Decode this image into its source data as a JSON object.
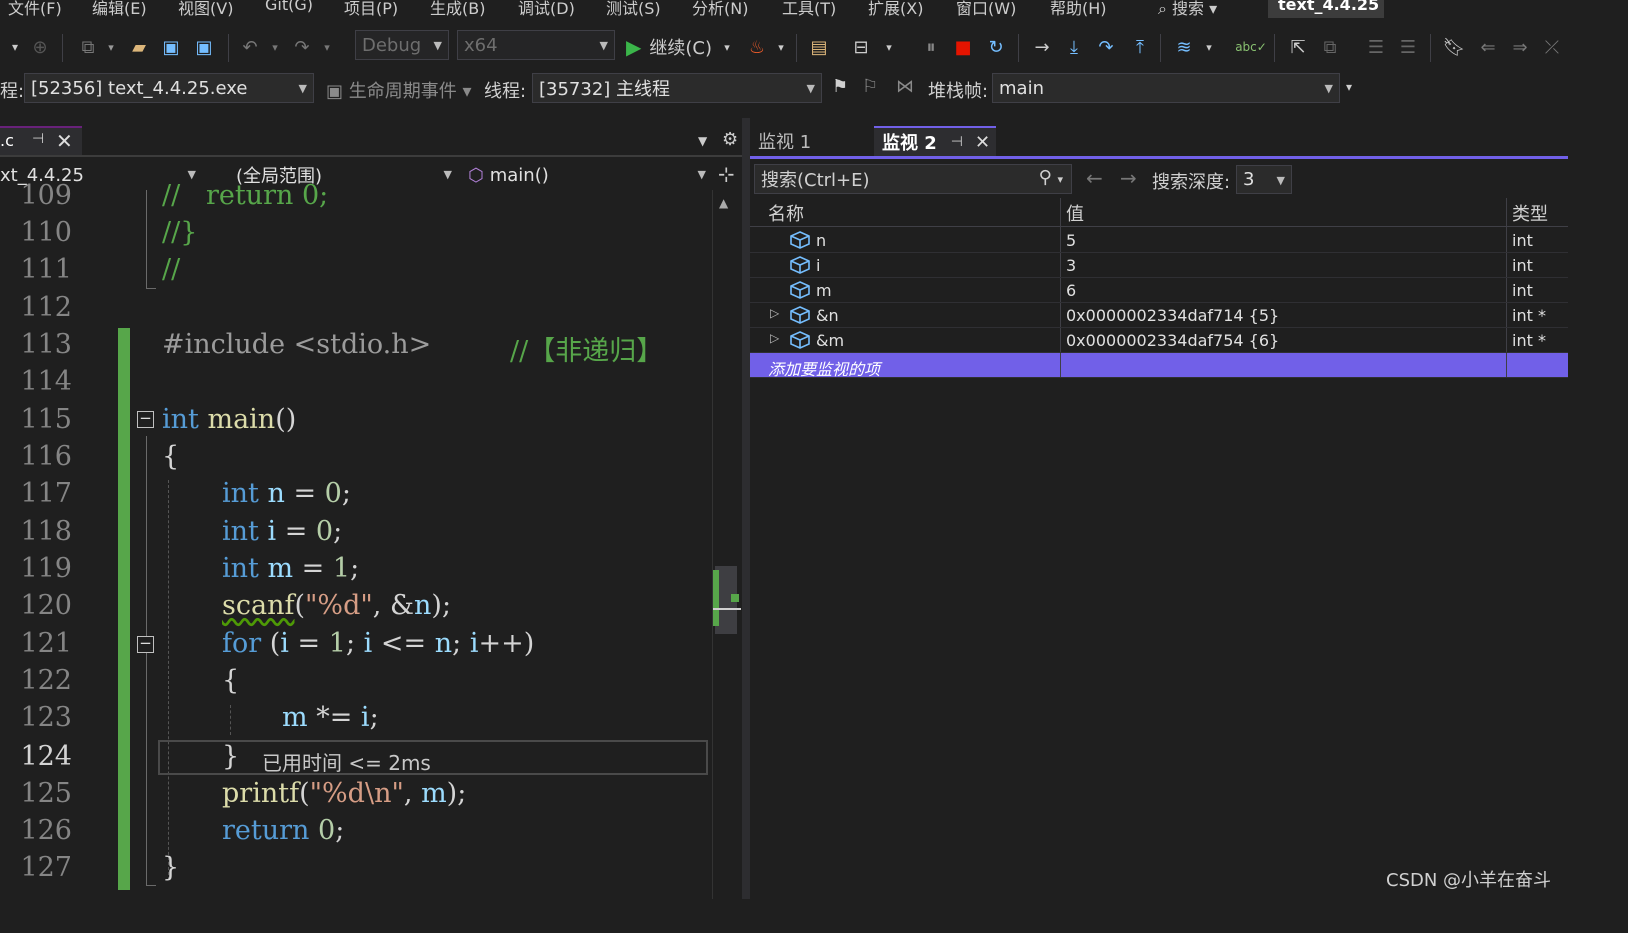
{
  "menu": [
    "文件(F)",
    "编辑(E)",
    "视图(V)",
    "Git(G)",
    "项目(P)",
    "生成(B)",
    "调试(D)",
    "测试(S)",
    "分析(N)",
    "工具(T)",
    "扩展(X)",
    "窗口(W)",
    "帮助(H)"
  ],
  "search_menu": "搜索",
  "project_title": "text_4.4.25",
  "toolbar": {
    "config": "Debug",
    "platform": "x64",
    "continue_label": "继续(C)"
  },
  "location": {
    "process_prefix": "程:",
    "process": "[52356] text_4.4.25.exe",
    "lifecycle": "生命周期事件",
    "thread_label": "线程:",
    "thread": "[35732] 主线程",
    "stack_label": "堆栈帧:",
    "stack": "main"
  },
  "editor": {
    "tab_label": ".c",
    "nav_project": "xt_4.4.25",
    "nav_scope": "(全局范围)",
    "nav_member": "main()",
    "inline_hint": "已用时间 <= 2ms",
    "current_line": "124",
    "lines": [
      {
        "num": "109",
        "text": "//   return 0;"
      },
      {
        "num": "110",
        "text": "//}"
      },
      {
        "num": "111",
        "text": "//"
      },
      {
        "num": "112",
        "text": ""
      },
      {
        "num": "113",
        "text": "#include <stdio.h>",
        "comment": "//【非递归】"
      },
      {
        "num": "114",
        "text": ""
      },
      {
        "num": "115",
        "text": "int main()"
      },
      {
        "num": "116",
        "text": "{"
      },
      {
        "num": "117",
        "text": "int n = 0;"
      },
      {
        "num": "118",
        "text": "int i = 0;"
      },
      {
        "num": "119",
        "text": "int m = 1;"
      },
      {
        "num": "120",
        "text": "scanf(\"%d\", &n);"
      },
      {
        "num": "121",
        "text": "for (i = 1; i <= n; i++)"
      },
      {
        "num": "122",
        "text": "{"
      },
      {
        "num": "123",
        "text": "m *= i;"
      },
      {
        "num": "124",
        "text": "}"
      },
      {
        "num": "125",
        "text": "printf(\"%d\\n\", m);"
      },
      {
        "num": "126",
        "text": "return 0;"
      },
      {
        "num": "127",
        "text": "}"
      }
    ]
  },
  "watch": {
    "tabs": [
      "监视 1",
      "监视 2"
    ],
    "search_placeholder": "搜索(Ctrl+E)",
    "depth_label": "搜索深度:",
    "depth_value": "3",
    "columns": [
      "名称",
      "值",
      "类型"
    ],
    "rows": [
      {
        "name": "n",
        "value": "5",
        "type": "int",
        "expandable": false
      },
      {
        "name": "i",
        "value": "3",
        "type": "int",
        "expandable": false
      },
      {
        "name": "m",
        "value": "6",
        "type": "int",
        "expandable": false
      },
      {
        "name": "&n",
        "value": "0x0000002334daf714 {5}",
        "type": "int *",
        "expandable": true
      },
      {
        "name": "&m",
        "value": "0x0000002334daf754 {6}",
        "type": "int *",
        "expandable": true
      }
    ],
    "add_item": "添加要监视的项"
  },
  "watermark": "CSDN @小羊在奋斗",
  "colors": {
    "background": "#1f1f1f",
    "accent": "#7160e8",
    "keyword": "#569cd6",
    "function": "#dcdcaa",
    "variable": "#9cdcfe",
    "string": "#d69d85",
    "comment": "#57a64a",
    "stop_red": "#e51400",
    "play_green": "#3bb54a"
  }
}
